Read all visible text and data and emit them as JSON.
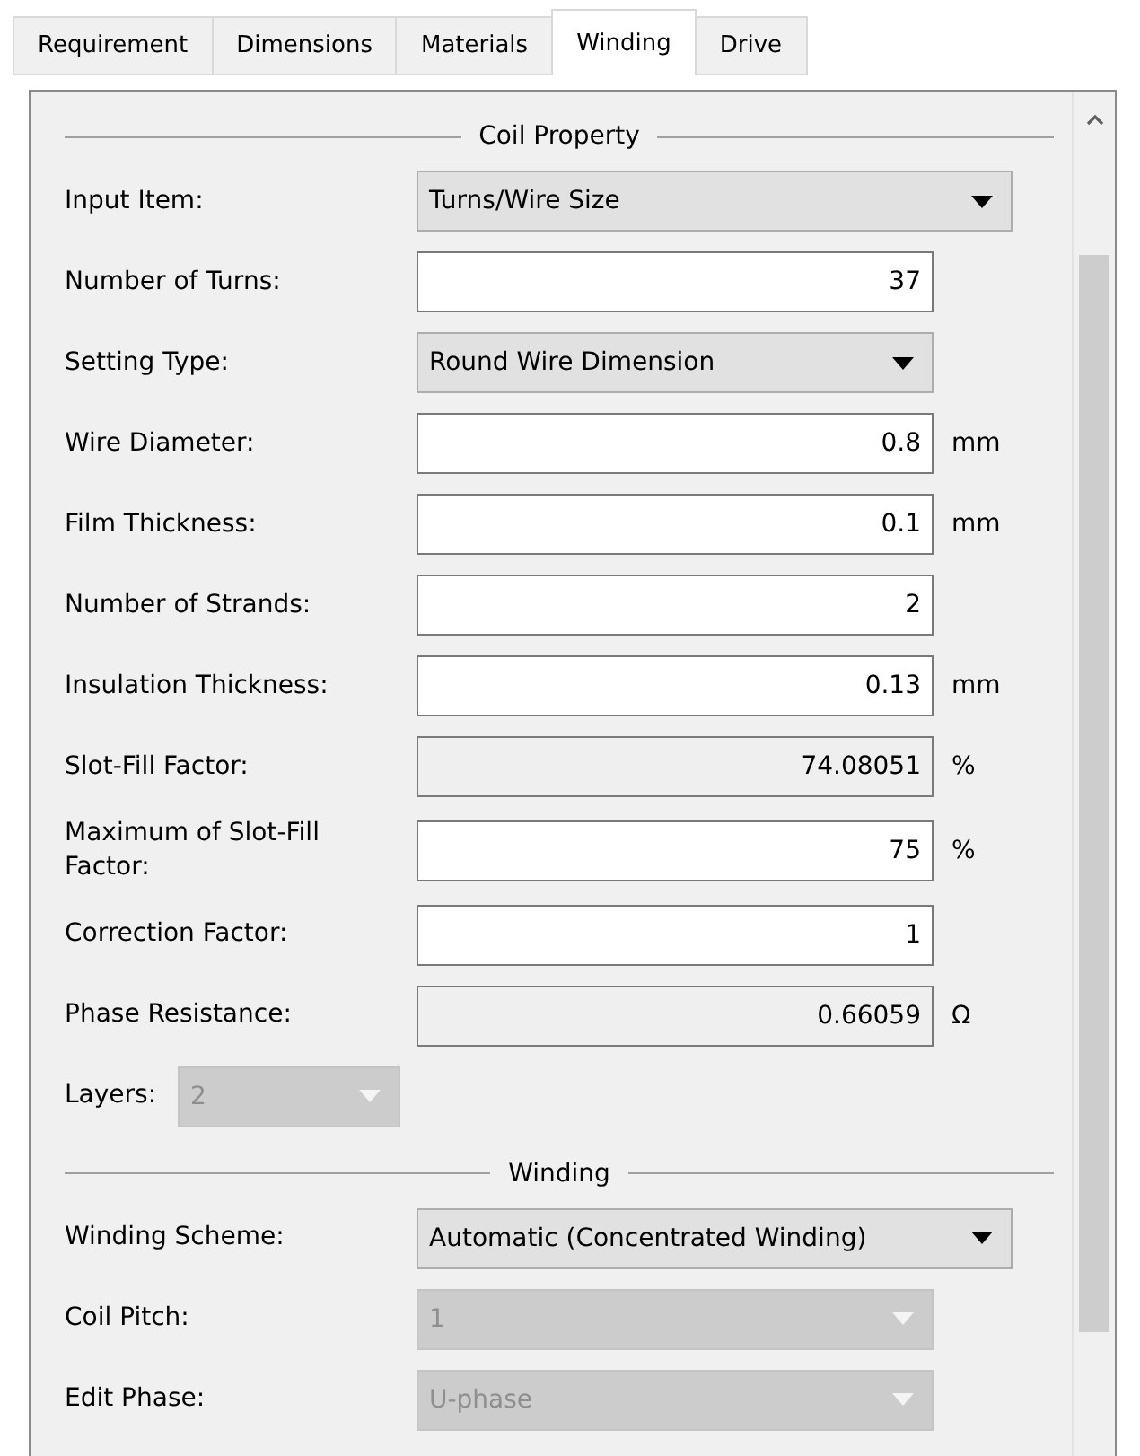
{
  "tabs": [
    {
      "label": "Requirement",
      "selected": false
    },
    {
      "label": "Dimensions",
      "selected": false
    },
    {
      "label": "Materials",
      "selected": false
    },
    {
      "label": "Winding",
      "selected": true
    },
    {
      "label": "Drive",
      "selected": false
    }
  ],
  "sections": [
    {
      "title": "Coil Property",
      "rows": [
        {
          "kind": "select_wide",
          "label": "Input Item:",
          "value": "Turns/Wire Size",
          "disabled": false
        },
        {
          "kind": "input",
          "label": "Number of Turns:",
          "value": "37"
        },
        {
          "kind": "select",
          "label": "Setting Type:",
          "value": "Round Wire Dimension",
          "disabled": false
        },
        {
          "kind": "input",
          "label": "Wire Diameter:",
          "value": "0.8",
          "unit": "mm"
        },
        {
          "kind": "input",
          "label": "Film Thickness:",
          "value": "0.1",
          "unit": "mm"
        },
        {
          "kind": "input",
          "label": "Number of Strands:",
          "value": "2"
        },
        {
          "kind": "input",
          "label": "Insulation Thickness:",
          "value": "0.13",
          "unit": "mm"
        },
        {
          "kind": "readonly",
          "label": "Slot-Fill Factor:",
          "value": "74.08051",
          "unit": "%"
        },
        {
          "kind": "input",
          "label": "Maximum of Slot-Fill Factor:",
          "value": "75",
          "unit": "%"
        },
        {
          "kind": "input",
          "label": "Correction Factor:",
          "value": "1"
        },
        {
          "kind": "readonly",
          "label": "Phase Resistance:",
          "value": "0.66059",
          "unit": "Ω"
        },
        {
          "kind": "select_inline",
          "label": "Layers:",
          "value": "2",
          "disabled": true
        }
      ]
    },
    {
      "title": "Winding",
      "rows": [
        {
          "kind": "select_wide",
          "label": "Winding Scheme:",
          "value": "Automatic (Concentrated Winding)",
          "disabled": false
        },
        {
          "kind": "select",
          "label": "Coil Pitch:",
          "value": "1",
          "disabled": true
        },
        {
          "kind": "select",
          "label": "Edit Phase:",
          "value": "U-phase",
          "disabled": true
        }
      ]
    }
  ]
}
